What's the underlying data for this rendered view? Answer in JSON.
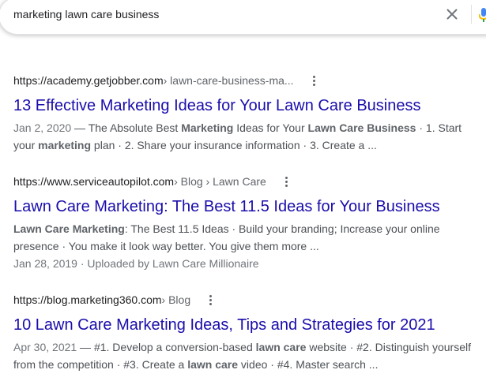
{
  "search": {
    "query": "marketing lawn care business",
    "clear_icon": "close-icon",
    "voice_icon": "mic-icon"
  },
  "results": [
    {
      "domain": "https://academy.getjobber.com",
      "path": " › lawn-care-business-ma...",
      "title": "13 Effective Marketing Ideas for Your Lawn Care Business",
      "snippet": {
        "date": "Jan 2, 2020",
        "p1": " — The Absolute Best ",
        "b1": "Marketing",
        "p2": " Ideas for Your ",
        "b2": "Lawn Care Business",
        "p3": " · 1. Start your ",
        "b3": "marketing",
        "p4": " plan · 2. Share your insurance information · 3. Create a ..."
      }
    },
    {
      "domain": "https://www.serviceautopilot.com",
      "path": " › Blog › Lawn Care",
      "title": "Lawn Care Marketing: The Best 11.5 Ideas for Your Business",
      "snippet": {
        "b1": "Lawn Care Marketing",
        "p1": ": The Best 11.5 Ideas · Build your branding; Increase your online presence · You make it look way better. You give them more ..."
      },
      "meta": "Jan 28, 2019 · Uploaded by Lawn Care Millionaire"
    },
    {
      "domain": "https://blog.marketing360.com",
      "path": " › Blog",
      "title": "10 Lawn Care Marketing Ideas, Tips and Strategies for 2021",
      "snippet": {
        "date": "Apr 30, 2021",
        "p1": " — #1. Develop a conversion-based ",
        "b1": "lawn care",
        "p2": " website · #2. Distinguish yourself from the competition · #3. Create a ",
        "b2": "lawn care",
        "p3": " video · #4. Master search ..."
      }
    }
  ],
  "colors": {
    "link": "#1a0dab",
    "text": "#4d5156",
    "muted": "#70757a",
    "cite": "#202124"
  }
}
